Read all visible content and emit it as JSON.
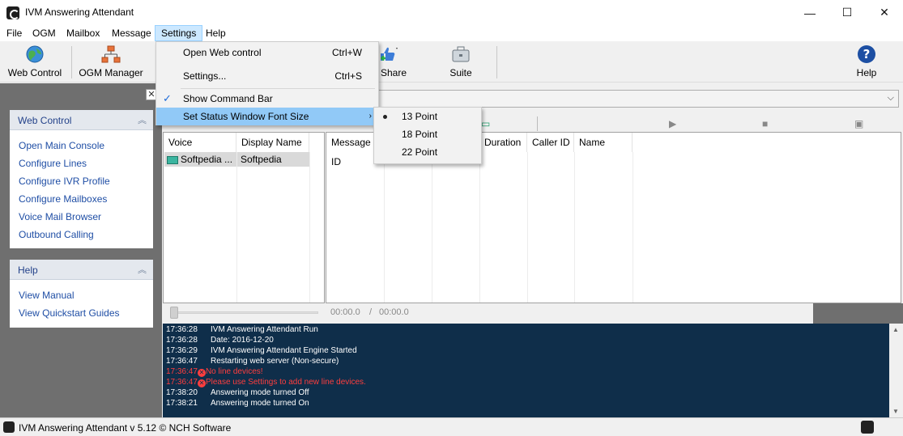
{
  "window": {
    "title": "IVM Answering Attendant",
    "controls": {
      "minimize": "—",
      "maximize": "☐",
      "close": "✕"
    }
  },
  "menubar": {
    "items": [
      "File",
      "OGM",
      "Mailbox",
      "Message",
      "Settings",
      "Help"
    ],
    "active": "Settings"
  },
  "toolbar": {
    "buttons": [
      {
        "label": "Web Control",
        "icon": "globe-icon"
      },
      {
        "label": "OGM Manager",
        "icon": "sitemap-icon"
      },
      {
        "label": "Share",
        "icon": "thumbs-up-icon"
      },
      {
        "label": "Suite",
        "icon": "briefcase-icon"
      },
      {
        "label": "Help",
        "icon": "help-icon"
      }
    ]
  },
  "settings_menu": {
    "items": [
      {
        "label": "Open Web control",
        "shortcut": "Ctrl+W"
      },
      {
        "label": "Settings...",
        "shortcut": "Ctrl+S"
      },
      {
        "label": "Show Command Bar",
        "checked": true
      },
      {
        "label": "Set Status Window Font Size",
        "submenu": true
      }
    ]
  },
  "font_size_submenu": {
    "items": [
      {
        "label": "13 Point",
        "selected": true
      },
      {
        "label": "18 Point"
      },
      {
        "label": "22 Point"
      }
    ]
  },
  "sidebar": {
    "web_control": {
      "title": "Web Control",
      "links": [
        "Open Main Console",
        "Configure Lines",
        "Configure IVR Profile",
        "Configure Mailboxes",
        "Voice Mail Browser",
        "Outbound Calling"
      ]
    },
    "help": {
      "title": "Help",
      "links": [
        "View Manual",
        "View Quickstart Guides"
      ]
    }
  },
  "mailboxes": {
    "columns": [
      "Voice Mailboxes",
      "Display Name"
    ],
    "rows": [
      {
        "mailbox": "Softpedia ...",
        "display_name": "Softpedia"
      }
    ]
  },
  "messages": {
    "columns": [
      "Message ID",
      "Duration",
      "Caller ID",
      "Name"
    ]
  },
  "player": {
    "position": "00:00.0",
    "separator": "/",
    "duration": "00:00.0"
  },
  "log": [
    {
      "time": "17:36:28",
      "text": "IVM Answering Attendant Run"
    },
    {
      "time": "17:36:28",
      "text": "Date: 2016-12-20"
    },
    {
      "time": "17:36:29",
      "text": "IVM Answering Attendant Engine Started"
    },
    {
      "time": "17:36:47",
      "text": "Restarting web server (Non-secure)"
    },
    {
      "time": "17:36:47",
      "text": "No line devices!",
      "error": true
    },
    {
      "time": "17:36:47",
      "text": "Please use Settings to add new line devices.",
      "error": true
    },
    {
      "time": "17:38:20",
      "text": "Answering mode turned Off"
    },
    {
      "time": "17:38:21",
      "text": "Answering mode turned On"
    }
  ],
  "statusbar": {
    "text": "IVM Answering Attendant v 5.12 © NCH Software"
  },
  "colors": {
    "log_background": "#0f2e4a",
    "error_text": "#ff3e3e",
    "link": "#1f4ea5",
    "menu_highlight": "#91c9f7"
  }
}
